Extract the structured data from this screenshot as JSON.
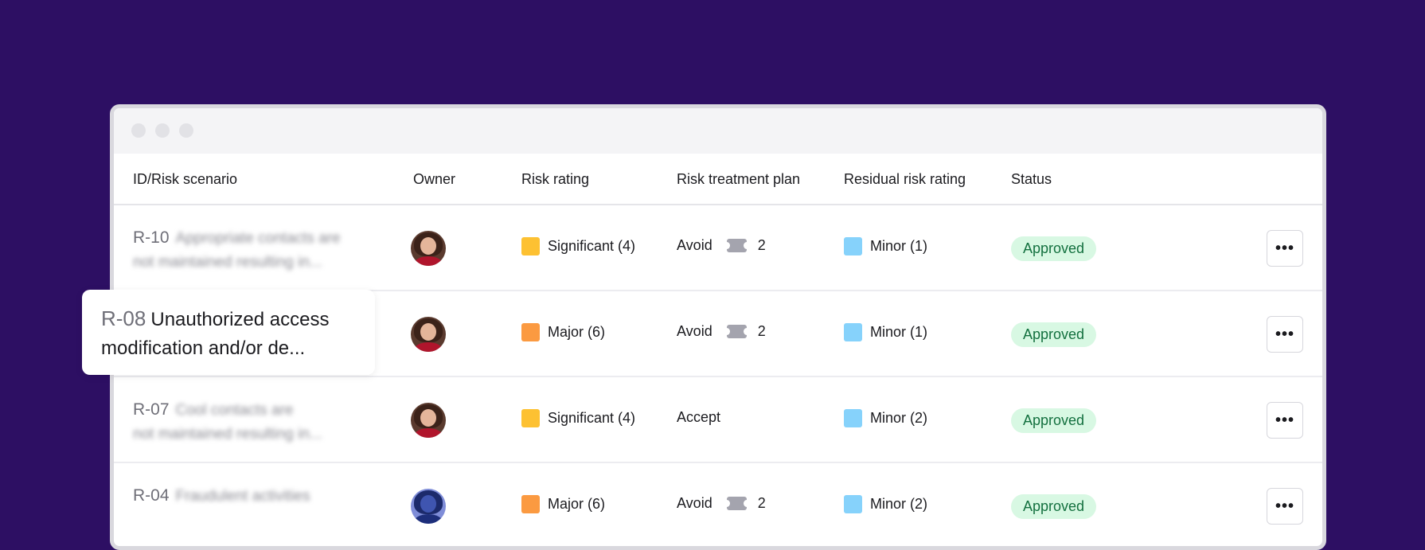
{
  "window": {
    "title": ""
  },
  "columns": {
    "scenario": "ID/Risk scenario",
    "owner": "Owner",
    "risk_rating": "Risk rating",
    "treatment_plan": "Risk treatment plan",
    "residual_rating": "Residual risk rating",
    "status": "Status"
  },
  "colors": {
    "background": "#2d0f63",
    "significant": "#fdc132",
    "major": "#fb9a41",
    "minor": "#86d2fb",
    "approved_bg": "#d8f8e3",
    "approved_text": "#13703f"
  },
  "rows": [
    {
      "id": "R-10",
      "scenario_line1": "Appropriate contacts are",
      "scenario_line2": "not maintained resulting in...",
      "risk_rating": "Significant (4)",
      "risk_color": "significant",
      "plan": "Avoid",
      "plan_count": "2",
      "residual": "Minor (1)",
      "status": "Approved",
      "more_icon": "•••"
    },
    {
      "id": "R-08",
      "scenario_line1": "Unauthorized access",
      "scenario_line2": "modification and/or de...",
      "risk_rating": "Major (6)",
      "risk_color": "major",
      "plan": "Avoid",
      "plan_count": "2",
      "residual": "Minor (1)",
      "status": "Approved",
      "more_icon": "•••"
    },
    {
      "id": "R-07",
      "scenario_line1": "Cool contacts are",
      "scenario_line2": "not maintained resulting in...",
      "risk_rating": "Significant (4)",
      "risk_color": "significant",
      "plan": "Accept",
      "plan_count": "",
      "residual": "Minor (2)",
      "status": "Approved",
      "more_icon": "•••"
    },
    {
      "id": "R-04",
      "scenario_line1": "Fraudulent activities",
      "scenario_line2": "",
      "risk_rating": "Major (6)",
      "risk_color": "major",
      "plan": "Avoid",
      "plan_count": "2",
      "residual": "Minor (2)",
      "status": "Approved",
      "more_icon": "•••"
    }
  ]
}
